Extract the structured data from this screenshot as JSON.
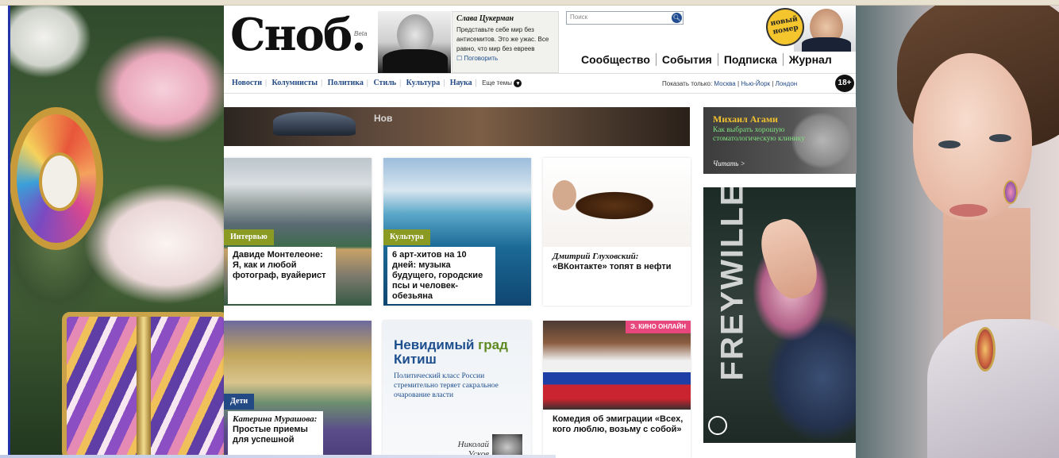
{
  "site": {
    "logo": "Сноб.",
    "beta": "Beta"
  },
  "column": {
    "author": "Слава Цукерман",
    "text": "Представьте себе мир без антисемитов. Это же ужас. Все равно, что мир без евреев",
    "talk": "☐ Поговорить"
  },
  "search": {
    "placeholder": "Поиск"
  },
  "newissue": {
    "label": "новый номер"
  },
  "mainnav": [
    "Сообщество",
    "События",
    "Подписка",
    "Журнал"
  ],
  "subnav": {
    "items": [
      "Новости",
      "Колумнисты",
      "Политика",
      "Стиль",
      "Культура",
      "Наука"
    ],
    "more": "Еще темы",
    "show_only": "Показать только:",
    "cities": [
      "Москва",
      "Нью-Йорк",
      "Лондон"
    ],
    "age": "18+"
  },
  "banner": {
    "text": "Нов"
  },
  "cards": [
    {
      "tag": "Интервью",
      "title": "Давиде Монтелеоне: Я, как и любой фотограф, вуайерист"
    },
    {
      "tag": "Культура",
      "title": "6 арт-хитов на 10 дней: музыка будущего, городские псы и человек-обезьяна"
    },
    {
      "author": "Дмитрий Глуховский:",
      "title": "«ВКонтакте» топят в нефти"
    },
    {
      "tag": "Дети",
      "author": "Катерина Мурашова:",
      "title": "Простые приемы для успешной"
    },
    {
      "title_a": "Невидимый ",
      "title_b": "град",
      "title_c": " Китиш",
      "lead": "Политический класс России стремительно теряет сакральное очарование власти",
      "author": "Николай Усков"
    },
    {
      "badge": "Э. КИНО ОНЛАЙН",
      "title": "Комедия об эмиграции «Всех, кого люблю, возьму с собой»"
    }
  ],
  "ad_agami": {
    "name": "Михаил Агами",
    "text": "Как выбрать хорошую стоматологическую клинику",
    "read": "Читать >"
  },
  "ad_freywille": {
    "brand": "FREYWILLE"
  },
  "colors": {
    "link": "#234a85",
    "tag_green": "#8a9a23",
    "kino_pink": "#e8477e",
    "ad_gold": "#f2c230"
  }
}
